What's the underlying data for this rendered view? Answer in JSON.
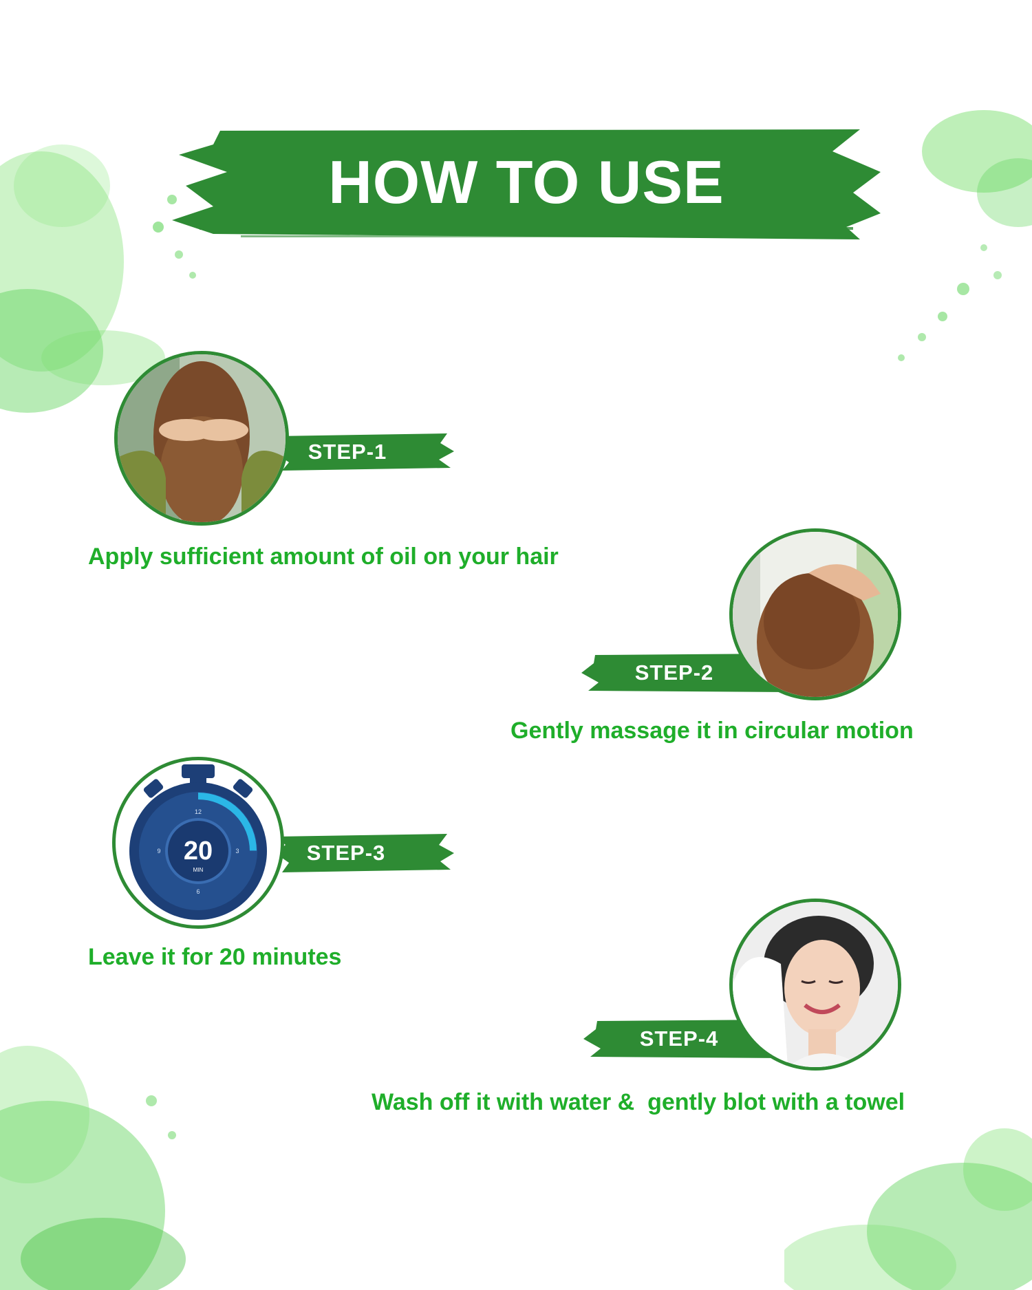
{
  "title": "HOW TO USE",
  "colors": {
    "brand_green": "#2e8b34",
    "caption_green": "#1fae2a",
    "splash_green": "#5fd35a"
  },
  "steps": [
    {
      "label": "STEP-1",
      "caption": "Apply sufficient amount of oil on your hair",
      "image": "woman-holding-hair-photo"
    },
    {
      "label": "STEP-2",
      "caption": "Gently massage it in circular motion",
      "image": "hand-massaging-scalp-photo"
    },
    {
      "label": "STEP-3",
      "caption": "Leave it for 20 minutes",
      "image": "stopwatch-icon"
    },
    {
      "label": "STEP-4",
      "caption": "Wash off it with water &  gently blot with a towel",
      "image": "woman-with-towel-photo"
    }
  ],
  "timer": {
    "value": "20",
    "unit": "MIN",
    "dial": [
      "12",
      "3",
      "6",
      "9"
    ]
  }
}
